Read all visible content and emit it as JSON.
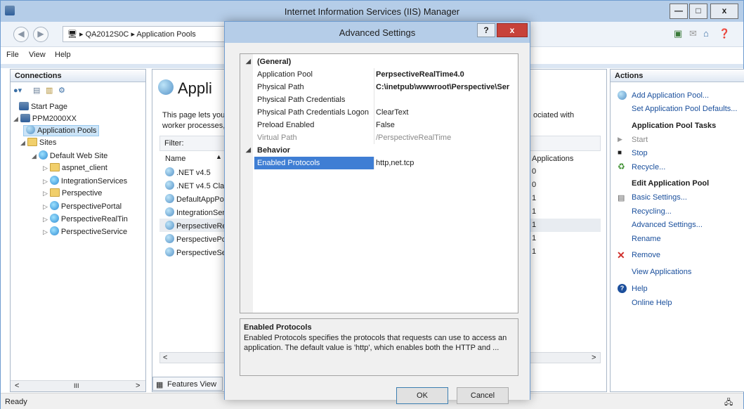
{
  "app": {
    "title": "Internet Information Services (IIS) Manager",
    "breadcrumb": [
      "QA2012S0C",
      "Application Pools"
    ],
    "menu": [
      "File",
      "View",
      "Help"
    ],
    "window_buttons": [
      "—",
      "□",
      "x"
    ]
  },
  "connections": {
    "header": "Connections",
    "tree": {
      "start_page": "Start Page",
      "server": "PPM2000XX",
      "app_pools": "Application Pools",
      "sites": "Sites",
      "default_site": "Default Web Site",
      "children": [
        "aspnet_client",
        "IntegrationServices",
        "Perspective",
        "PerspectivePortal",
        "PerspectiveRealTin",
        "PerspectiveService"
      ]
    },
    "scroll_label": "III"
  },
  "center": {
    "title": "Appli",
    "desc_left": "This page lets you worker processes,",
    "desc_right": "ociated with",
    "filter_label": "Filter:",
    "col_name": "Name",
    "col_apps": "Applications",
    "rows": [
      {
        "name": ".NET v4.5",
        "apps": "0"
      },
      {
        "name": ".NET v4.5 Clas",
        "apps": "0"
      },
      {
        "name": "DefaultAppPo",
        "apps": "1"
      },
      {
        "name": "IntegrationSer",
        "apps": "1"
      },
      {
        "name": "PerpsectiveRe",
        "apps": "1"
      },
      {
        "name": "PerspectivePo",
        "apps": "1"
      },
      {
        "name": "PerspectiveSer",
        "apps": "1"
      }
    ],
    "features_tab": "Features View"
  },
  "actions": {
    "header": "Actions",
    "top": [
      "Add Application Pool...",
      "Set Application Pool Defaults..."
    ],
    "tasks_header": "Application Pool Tasks",
    "tasks": [
      "Start",
      "Stop",
      "Recycle..."
    ],
    "edit_header": "Edit Application Pool",
    "edit": [
      "Basic Settings...",
      "Recycling...",
      "Advanced Settings...",
      "Rename"
    ],
    "remove": "Remove",
    "view_apps": "View Applications",
    "help": "Help",
    "online_help": "Online Help"
  },
  "status": "Ready",
  "dialog": {
    "title": "Advanced Settings",
    "help_btn": "?",
    "close_btn": "x",
    "general_cat": "(General)",
    "behavior_cat": "Behavior",
    "props": [
      {
        "name": "Application Pool",
        "value": "PerpsectiveRealTime4.0"
      },
      {
        "name": "Physical Path",
        "value": "C:\\inetpub\\wwwroot\\Perspective\\Ser"
      },
      {
        "name": "Physical Path Credentials",
        "value": ""
      },
      {
        "name": "Physical Path Credentials Logon",
        "value": "ClearText"
      },
      {
        "name": "Preload Enabled",
        "value": "False"
      },
      {
        "name": "Virtual Path",
        "value": "/PerspectiveRealTime"
      }
    ],
    "selected_prop": {
      "name": "Enabled Protocols",
      "value": "http,net.tcp"
    },
    "desc_title": "Enabled Protocols",
    "desc_text": "Enabled Protocols specifies the protocols that requests can use to access an application. The default value is 'http', which enables both the HTTP and ...",
    "ok": "OK",
    "cancel": "Cancel"
  }
}
